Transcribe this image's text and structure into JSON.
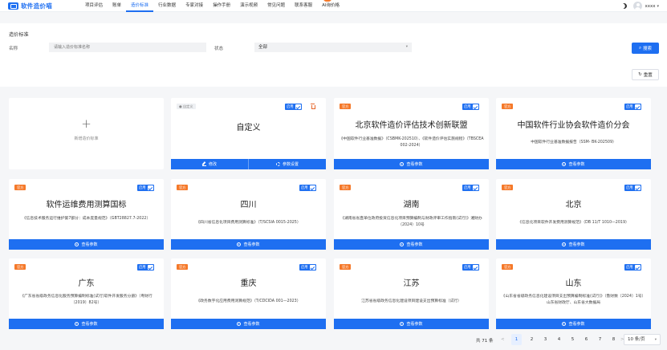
{
  "app": {
    "logo_text": "软件造价喵",
    "nav": [
      {
        "label": "项目评估",
        "active": false
      },
      {
        "label": "账单",
        "active": false
      },
      {
        "label": "造价标准",
        "active": true
      },
      {
        "label": "行业数据",
        "active": false
      },
      {
        "label": "专家对接",
        "active": false
      },
      {
        "label": "操作手册",
        "active": false
      },
      {
        "label": "演示视频",
        "active": false
      },
      {
        "label": "常见问题",
        "active": false
      },
      {
        "label": "联系客服",
        "active": false
      },
      {
        "label": "AI询价格",
        "active": false,
        "badge": "·"
      }
    ],
    "username": "xxxx"
  },
  "filter": {
    "title": "造价标准",
    "name_label": "名称",
    "name_placeholder": "请输入造价标准名称",
    "status_label": "状态",
    "status_value": "全部",
    "search_label": "搜索",
    "reset_label": "重置"
  },
  "add_card": {
    "plus": "+",
    "label": "新增造价标准"
  },
  "custom_card": {
    "tag": "● 自定义",
    "enable_label": "启用",
    "title": "自定义",
    "edit_label": "修改",
    "params_label": "参数设置"
  },
  "cards": [
    {
      "tag": "官方",
      "enable_label": "启用",
      "title": "北京软件造价评估技术创新联盟",
      "desc": "《中国软件行业基准数据》（CSBMK-202510）、《软件造价评估实施规程》（TBSCEA 002-2024）",
      "action": "查看参数"
    },
    {
      "tag": "官方",
      "enable_label": "启用",
      "title": "中国软件行业协会软件造价分会",
      "desc": "中国软件行业基准数据报告（SSM- BK-202509）",
      "action": "查看参数"
    },
    {
      "tag": "官方",
      "enable_label": "启用",
      "title": "软件运维费用测算国标",
      "desc": "《信息技术服务运行维护第7部分：成本度量规范》（GBT28827.7-2022）",
      "action": "查看参数"
    },
    {
      "tag": "官方",
      "enable_label": "启用",
      "title": "四川",
      "desc": "《四川省信息化项目费用测算标准》（T/SCSIA 0015-2025）",
      "action": "查看参数"
    },
    {
      "tag": "官方",
      "enable_label": "启用",
      "title": "湖南",
      "desc": "《湖南省省直单位政府投资信息化项目预算编制与财政评审工作指南(试行)》湘财办（2024）10号",
      "action": "查看参数"
    },
    {
      "tag": "官方",
      "enable_label": "启用",
      "title": "北京",
      "desc": "《信息化项目软件开发费用测算规范》（DB 11/T 1010—2019）",
      "action": "查看参数"
    },
    {
      "tag": "官方",
      "enable_label": "启用",
      "title": "广东",
      "desc": "《广东省省级政务信息化服务预算编制标准(试行)软件开发服务分册》（粤财行〔2019〕82号）",
      "action": "查看参数"
    },
    {
      "tag": "官方",
      "enable_label": "启用",
      "title": "重庆",
      "desc": "《政务数字化应用费用测算规范》（T/CDCIDA 001—2023）",
      "action": "查看参数"
    },
    {
      "tag": "官方",
      "enable_label": "启用",
      "title": "江苏",
      "desc": "江苏省省级政务信息化建设项目建设支出预算标准（试行）",
      "action": "查看参数"
    },
    {
      "tag": "官方",
      "enable_label": "启用",
      "title": "山东",
      "desc": "《山东省省级政务信息化建设项目支出预算编制标准(试行)》（鲁财数〔2024〕1号）山东省财政厅、山东省大数据局",
      "action": "查看参数"
    }
  ],
  "pagination": {
    "total": "共 71 条",
    "prev": "<",
    "next": ">",
    "pages": [
      "1",
      "2",
      "3",
      "4",
      "5",
      "6",
      "7",
      "8"
    ],
    "current": "1",
    "page_size": "10 条/页"
  },
  "colors": {
    "primary": "#1e6ff1",
    "official_tag": "#f5792a",
    "delete": "#e6662a"
  }
}
